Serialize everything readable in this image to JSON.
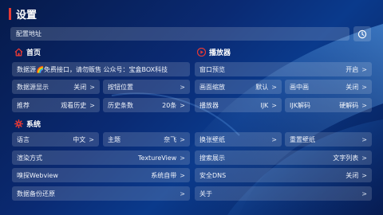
{
  "header": {
    "title": "设置"
  },
  "config": {
    "label": "配置地址"
  },
  "home": {
    "title": "首页",
    "source": "数据源🌈免费接口，请勿贩售 公众号：宝盒BOX科技",
    "display": {
      "label": "数据源显示",
      "value": "关闭"
    },
    "button_pos": {
      "label": "按钮位置"
    },
    "recommend": {
      "label": "推荐",
      "value": "观看历史"
    },
    "history_count": {
      "label": "历史条数",
      "value": "20条"
    }
  },
  "player": {
    "title": "播放器",
    "window_preview": {
      "label": "窗口预览",
      "value": "开启"
    },
    "screen_scale": {
      "label": "画面缩放",
      "value": "默认"
    },
    "pip": {
      "label": "画中画",
      "value": "关闭"
    },
    "engine": {
      "label": "播放器",
      "value": "IJK"
    },
    "ijk_decode": {
      "label": "IJK解码",
      "value": "硬解码"
    }
  },
  "system": {
    "title": "系统",
    "language": {
      "label": "语言",
      "value": "中文"
    },
    "theme": {
      "label": "主题",
      "value": "奈飞"
    },
    "render": {
      "label": "渲染方式",
      "value": "TextureView"
    },
    "webview": {
      "label": "嗅探Webview",
      "value": "系统自带"
    },
    "backup": {
      "label": "数据备份还原"
    },
    "wallpaper": {
      "label": "换张壁纸"
    },
    "reset_wallpaper": {
      "label": "重置壁纸"
    },
    "search_display": {
      "label": "搜索展示",
      "value": "文字列表"
    },
    "dns": {
      "label": "安全DNS",
      "value": "关闭"
    },
    "about": {
      "label": "关于"
    }
  },
  "chevron": ">",
  "colors": {
    "accent": "#e53935",
    "background": "#0a2a73"
  }
}
